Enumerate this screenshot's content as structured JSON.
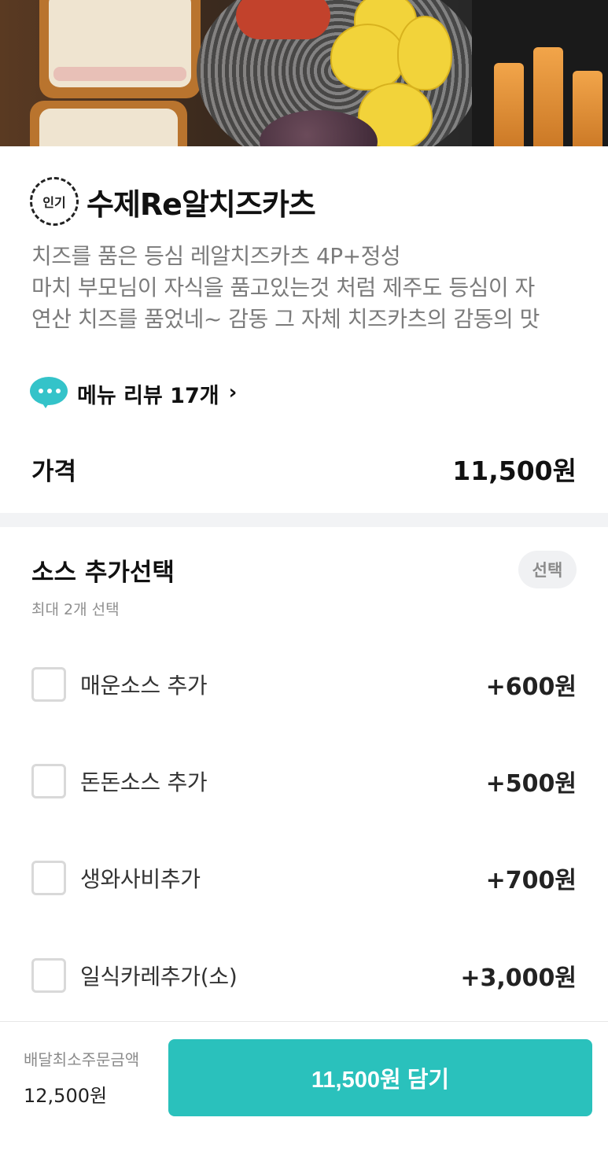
{
  "menu": {
    "badge": "인기",
    "title": "수제Re알치즈카츠",
    "description_lines": [
      "치즈를 품은 등심 레알치즈카츠 4P+정성",
      "마치 부모님이 자식을 품고있는것 처럼 제주도 등심이 자",
      "연산 치즈를 품었네~ 감동 그 자체 치즈카츠의 감동의 맛"
    ],
    "review_link": "메뉴 리뷰 17개",
    "price_label": "가격",
    "price_value": "11,500원"
  },
  "options": {
    "title": "소스 추가선택",
    "badge": "선택",
    "subtitle": "최대 2개 선택",
    "items": [
      {
        "label": "매운소스 추가",
        "price": "+600원"
      },
      {
        "label": "돈돈소스 추가",
        "price": "+500원"
      },
      {
        "label": "생와사비추가",
        "price": "+700원"
      },
      {
        "label": "일식카레추가(소)",
        "price": "+3,000원"
      }
    ]
  },
  "bottom": {
    "min_order_label": "배달최소주문금액",
    "min_order_value": "12,500원",
    "add_button": "11,500원 담기"
  },
  "colors": {
    "accent": "#2ac1bc",
    "review_icon": "#34c3c9",
    "divider": "#f2f3f5"
  },
  "icons": {
    "review": "speech-bubble-icon",
    "chevron": "chevron-right-icon",
    "badge": "popular-badge-icon"
  }
}
